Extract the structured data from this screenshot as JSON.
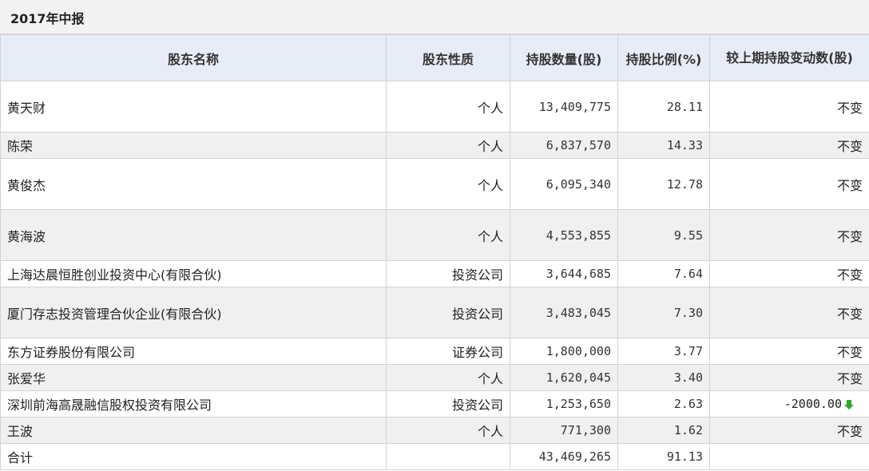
{
  "report": {
    "title": "2017年中报"
  },
  "table": {
    "headers": [
      "股东名称",
      "股东性质",
      "持股数量(股)",
      "持股比例(%)",
      "较上期持股变动数(股)"
    ],
    "rows": [
      {
        "name": "黄天财",
        "type": "个人",
        "shares": "13,409,775",
        "ratio": "28.11",
        "change": "不变"
      },
      {
        "name": "陈荣",
        "type": "个人",
        "shares": "6,837,570",
        "ratio": "14.33",
        "change": "不变"
      },
      {
        "name": "黄俊杰",
        "type": "个人",
        "shares": "6,095,340",
        "ratio": "12.78",
        "change": "不变"
      },
      {
        "name": "黄海波",
        "type": "个人",
        "shares": "4,553,855",
        "ratio": "9.55",
        "change": "不变"
      },
      {
        "name": "上海达晨恒胜创业投资中心(有限合伙)",
        "type": "投资公司",
        "shares": "3,644,685",
        "ratio": "7.64",
        "change": "不变"
      },
      {
        "name": "厦门存志投资管理合伙企业(有限合伙)",
        "type": "投资公司",
        "shares": "3,483,045",
        "ratio": "7.30",
        "change": "不变"
      },
      {
        "name": "东方证券股份有限公司",
        "type": "证券公司",
        "shares": "1,800,000",
        "ratio": "3.77",
        "change": "不变"
      },
      {
        "name": "张爱华",
        "type": "个人",
        "shares": "1,620,045",
        "ratio": "3.40",
        "change": "不变"
      },
      {
        "name": "深圳前海高晟融信股权投资有限公司",
        "type": "投资公司",
        "shares": "1,253,650",
        "ratio": "2.63",
        "change": "-2000.00"
      },
      {
        "name": "王波",
        "type": "个人",
        "shares": "771,300",
        "ratio": "1.62",
        "change": "不变"
      }
    ],
    "total": {
      "label": "合计",
      "shares": "43,469,265",
      "ratio": "91.13"
    }
  },
  "colors": {
    "header_bg": "#e6edf7",
    "alt_row_bg": "#f0f0f0",
    "down_arrow": "#2eaa2e"
  },
  "icons": {
    "change_down": "down-arrow-icon"
  }
}
